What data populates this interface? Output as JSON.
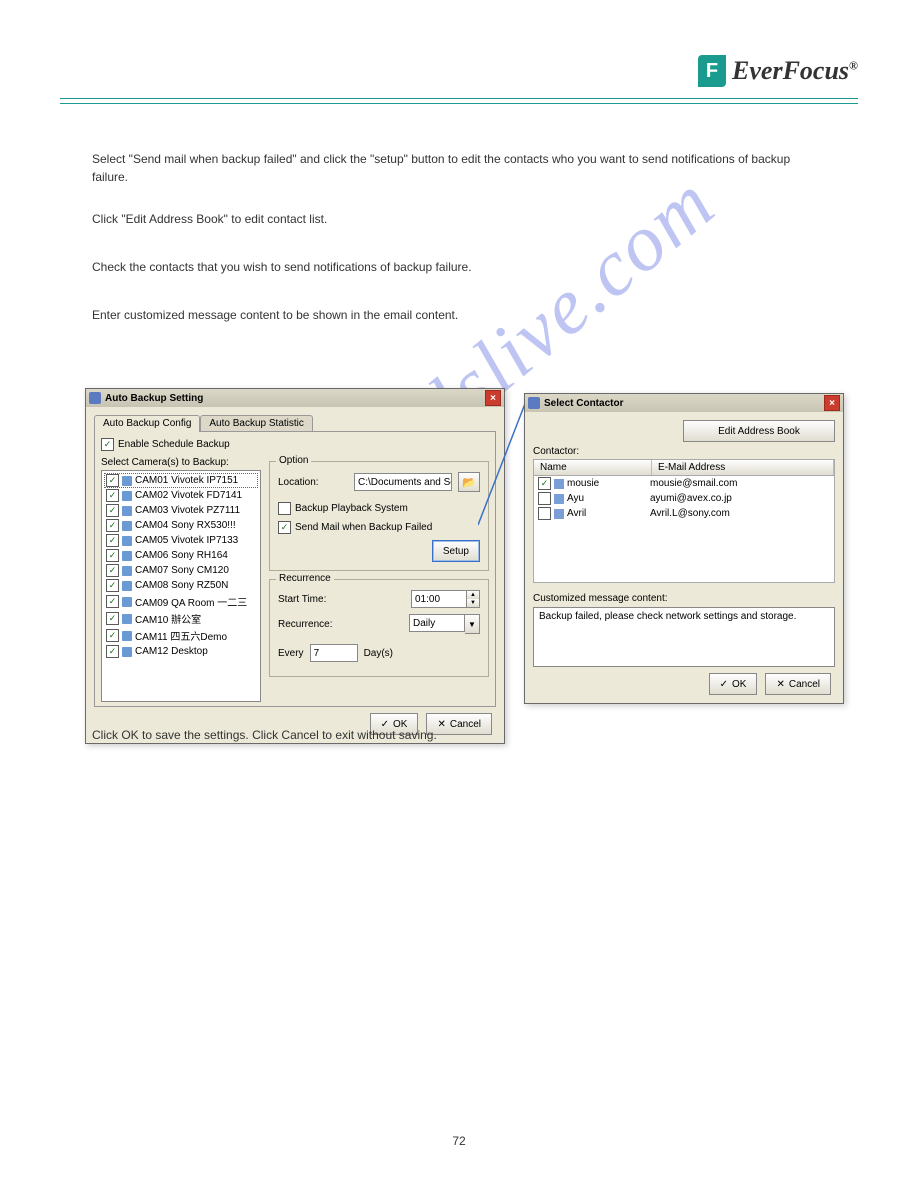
{
  "header": {
    "brand": "EverFocus",
    "logo_letter": "F",
    "registered": "®"
  },
  "paragraphs": {
    "p1": "Select \"Send mail when backup failed\" and click the \"setup\" button to edit the contacts who you want to send notifications of backup failure.",
    "p2": "Click \"Edit Address Book\" to edit contact list.",
    "p3": "Check the contacts that you wish to send notifications of backup failure.",
    "p4": "Enter customized message content to be shown in the email content.",
    "outro": "Click OK to save the settings. Click Cancel to exit without saving."
  },
  "window1": {
    "title": "Auto Backup Setting",
    "tab1": "Auto Backup Config",
    "tab2": "Auto Backup Statistic",
    "enable_label": "Enable Schedule Backup",
    "camlist_label": "Select Camera(s) to Backup:",
    "cameras": [
      "CAM01 Vivotek IP7151",
      "CAM02 Vivotek FD7141",
      "CAM03 Vivotek PZ7111",
      "CAM04 Sony RX530!!!",
      "CAM05 Vivotek IP7133",
      "CAM06 Sony RH164",
      "CAM07 Sony CM120",
      "CAM08 Sony RZ50N",
      "CAM09 QA Room 一二三",
      "CAM10 辦公室",
      "CAM11 四五六Demo",
      "CAM12 Desktop"
    ],
    "option_title": "Option",
    "location_label": "Location:",
    "location_value": "C:\\Documents and Se",
    "option_cb1": "Backup Playback System",
    "option_cb2": "Send Mail when Backup Failed",
    "setup_btn": "Setup",
    "recurrence_title": "Recurrence",
    "start_time_label": "Start Time:",
    "start_time_value": "01:00",
    "recurrence_label": "Recurrence:",
    "recurrence_value": "Daily",
    "every_label": "Every",
    "every_value": "7",
    "days_label": "Day(s)",
    "ok": "OK",
    "cancel": "Cancel"
  },
  "window2": {
    "title": "Select Contactor",
    "edit_btn": "Edit Address Book",
    "contactor_label": "Contactor:",
    "col_name": "Name",
    "col_email": "E-Mail Address",
    "rows": [
      {
        "checked": true,
        "name": "mousie",
        "email": "mousie@smail.com"
      },
      {
        "checked": false,
        "name": "Ayu",
        "email": "ayumi@avex.co.jp"
      },
      {
        "checked": false,
        "name": "Avril",
        "email": "Avril.L@sony.com"
      }
    ],
    "msg_label": "Customized message content:",
    "msg_value": "Backup failed, please check network settings and storage.",
    "ok": "OK",
    "cancel": "Cancel"
  },
  "watermark": "manualslive.com",
  "page_number": "72"
}
